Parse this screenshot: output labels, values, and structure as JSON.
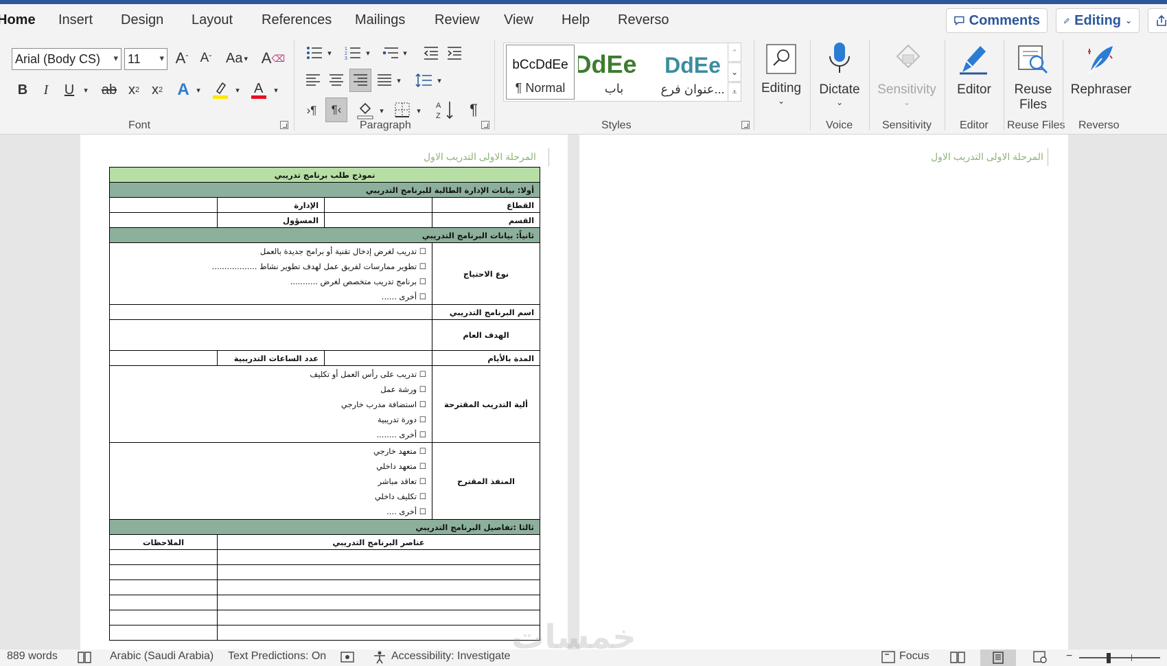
{
  "tabs": [
    "Home",
    "Insert",
    "Design",
    "Layout",
    "References",
    "Mailings",
    "Review",
    "View",
    "Help",
    "Reverso"
  ],
  "top_buttons": {
    "comments": "Comments",
    "editing": "Editing"
  },
  "font": {
    "name": "Arial (Body CS)",
    "size": "11",
    "group_label": "Font",
    "change_case": "Aa"
  },
  "paragraph": {
    "group_label": "Paragraph"
  },
  "styles": {
    "group_label": "Styles",
    "items": [
      {
        "preview": "bCcDdEe",
        "name": "¶ Normal"
      },
      {
        "preview": "DdEe",
        "name": "باب"
      },
      {
        "preview": "DdEe",
        "name": "عنوان فرع..."
      }
    ]
  },
  "editing": {
    "label": "Editing"
  },
  "voice": {
    "dictate": "Dictate",
    "group_label": "Voice"
  },
  "sensitivity": {
    "label": "Sensitivity",
    "group_label": "Sensitivity"
  },
  "editor": {
    "label": "Editor",
    "group_label": "Editor"
  },
  "reuse": {
    "label1": "Reuse",
    "label2": "Files",
    "group_label": "Reuse Files"
  },
  "rephraser": {
    "label": "Rephraser",
    "group_label": "Reverso"
  },
  "document": {
    "header": "المرحلة الاولى التدريب الاول",
    "form": {
      "title": "نموذج طلب برنامج تدريبي",
      "section1": "أولا: بيانات الإدارة الطالبة للبرنامج التدريبي",
      "sector": "القطاع",
      "department": "الإدارة",
      "division": "القسم",
      "responsible": "المسؤول",
      "section2": "ثانياً: بيانات البرنامج التدريبي",
      "need_type": "نوع الاحتياج",
      "need_options": [
        "☐ تدريب لغرض إدخال تقنية أو برامج جديدة بالعمل",
        "☐ تطوير ممارسات لفريق عمل لهدف تطوير نشاط ..................",
        "☐ برنامج تدريب متخصص لغرض ...........",
        "☐ أخرى ......"
      ],
      "program_name": "اسم البرنامج التدريبي",
      "goal": "الهدف العام",
      "duration": "المدة بالأيام",
      "hours": "عدد الساعات التدريبية",
      "mechanism": "ألية التدريب المقترحة",
      "mechanism_options": [
        "☐ تدريب على رأس العمل أو تكليف",
        "☐ ورشة عمل",
        "☐ استضافة مدرب خارجي",
        "☐ دورة تدريبية",
        "☐ أخرى ........"
      ],
      "implementer": "المنفذ المقترح",
      "implementer_options": [
        "☐ متعهد خارجي",
        "☐ متعهد داخلي",
        "☐ تعاقد مباشر",
        "☐ تكليف داخلي",
        "☐ أخرى ...."
      ],
      "section3": "ثالثا :تفاصيل البرنامج التدريبي",
      "elements": "عناصر البرنامج التدريبي",
      "notes": "الملاحظات"
    }
  },
  "status": {
    "words": "889 words",
    "language": "Arabic (Saudi Arabia)",
    "predictions": "Text Predictions: On",
    "accessibility": "Accessibility: Investigate",
    "focus": "Focus"
  },
  "watermark": "خمسات"
}
